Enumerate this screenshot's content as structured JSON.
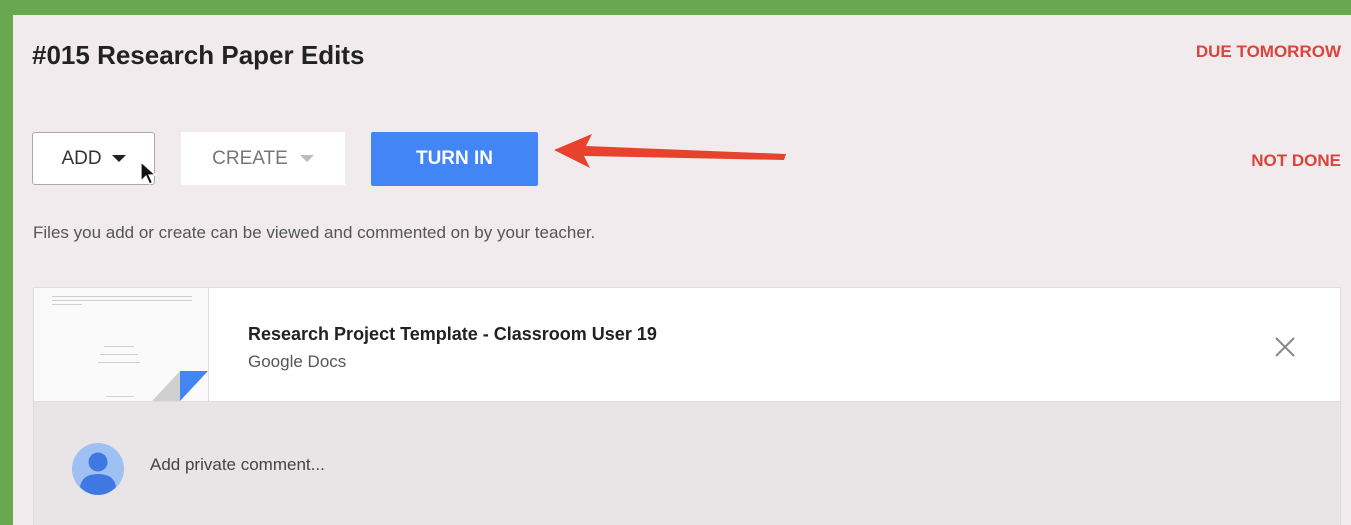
{
  "assignment": {
    "title": "#015 Research Paper Edits",
    "due": "DUE TOMORROW",
    "status": "NOT DONE"
  },
  "toolbar": {
    "add_label": "ADD",
    "create_label": "CREATE",
    "turn_in_label": "TURN IN"
  },
  "hint": "Files you add or create can be viewed and commented on by your teacher.",
  "attachment": {
    "name": "Research Project Template - Classroom User 19",
    "type": "Google Docs"
  },
  "comment": {
    "placeholder": "Add private comment..."
  },
  "colors": {
    "background": "#6aa84f",
    "accent": "#4285f4",
    "alert": "#d9453a",
    "annotation_arrow": "#e8412c"
  },
  "icons": [
    "caret-down-icon",
    "mouse-pointer-icon",
    "red-arrow-icon",
    "close-icon",
    "person-avatar-icon",
    "doc-corner-icon"
  ]
}
